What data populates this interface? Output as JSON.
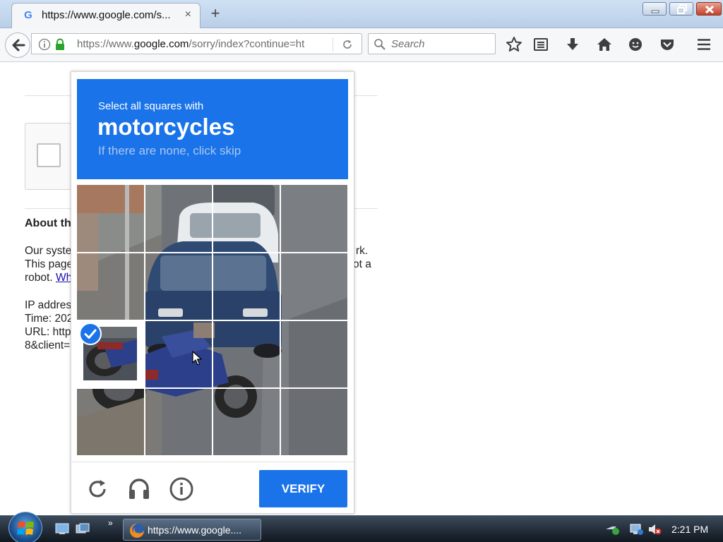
{
  "browser": {
    "tab_title": "https://www.google.com/s...",
    "tab_close": "×",
    "new_tab": "+",
    "favicon": "G",
    "url_prefix": "https://www.",
    "url_host": "google.com",
    "url_rest": "/sorry/index?continue=ht",
    "search_placeholder": "Search"
  },
  "page": {
    "about_heading": "About th",
    "para1_left": "Our syste",
    "para1_right": "rk.",
    "para2_left": "This page",
    "para2_right": "ot a",
    "para3_left": "robot. ",
    "para3_link": "Wh",
    "ip_label": "IP addres",
    "time_label": "Time: 202",
    "url_label": "URL: http",
    "client_label": "8&client="
  },
  "challenge": {
    "instruction": "Select all squares with",
    "target": "motorcycles",
    "hint": "If there are none, click skip",
    "verify_label": "VERIFY",
    "selected_tiles": [
      [
        2,
        0
      ]
    ]
  },
  "taskbar": {
    "task_label": "https://www.google....",
    "clock": "2:21 PM"
  },
  "colors": {
    "recaptcha_blue": "#1a73e8",
    "link": "#1a0dab"
  },
  "icons": [
    "back-icon",
    "info-icon",
    "lock-icon",
    "reload-icon",
    "search-icon",
    "bookmark-star-icon",
    "reading-list-icon",
    "download-icon",
    "home-icon",
    "smiley-icon",
    "pocket-icon",
    "menu-icon",
    "refresh-challenge-icon",
    "audio-challenge-icon",
    "info-challenge-icon",
    "checkmark-icon",
    "windows-start-icon",
    "firefox-icon",
    "network-icon",
    "volume-icon"
  ]
}
